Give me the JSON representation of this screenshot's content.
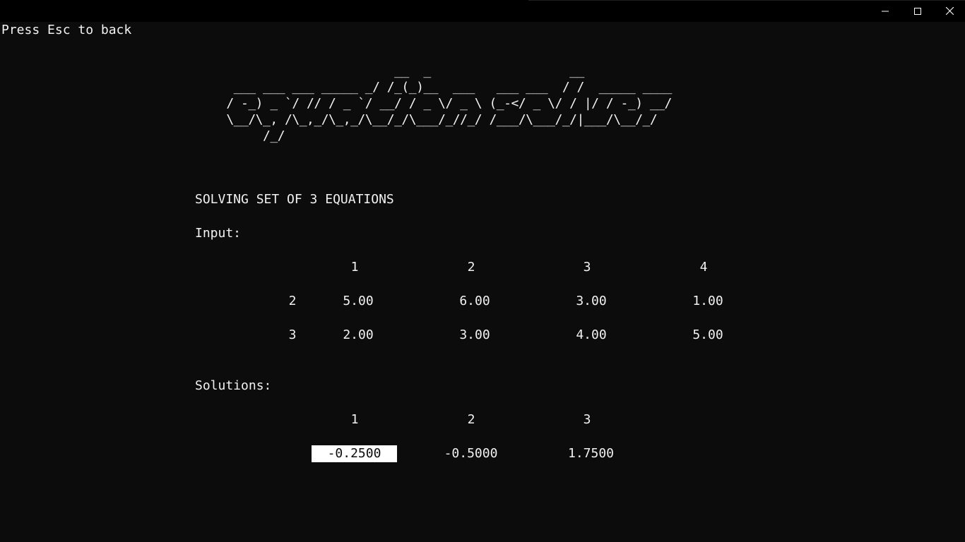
{
  "window": {
    "controls": {
      "minimize_icon": "minimize-icon",
      "maximize_icon": "maximize-icon",
      "close_icon": "close-icon"
    }
  },
  "hint": "Press Esc to back",
  "banner": {
    "text": "                        __  _                   __\n  ___ ___ ___ _____ _/ /_(_)__  ___   ___ ___  / /  _____ ____\n / -_) _ `/ // / _ `/ __/ / _ \\/ _ \\ (_-</ _ \\/ / |/ / -_) __/\n \\__/\\_, /\\_,_/\\_,_/\\__/_/\\___/_//_/ /___/\\___/_/|___/\\__/_/\n      /_/"
  },
  "heading": "SOLVING SET OF 3 EQUATIONS",
  "input": {
    "label": "Input:",
    "columns": [
      "1",
      "2",
      "3",
      "4"
    ],
    "rows": [
      {
        "index": "2",
        "values": [
          "5.00",
          "6.00",
          "3.00",
          "1.00"
        ]
      },
      {
        "index": "3",
        "values": [
          "2.00",
          "3.00",
          "4.00",
          "5.00"
        ]
      }
    ]
  },
  "solutions": {
    "label": "Solutions:",
    "columns": [
      "1",
      "2",
      "3"
    ],
    "values": [
      "-0.2500",
      "-0.5000",
      "1.7500"
    ],
    "selected_index": 0
  },
  "colors": {
    "background": "#0c0c0c",
    "foreground": "#f2f2f2",
    "selection_bg": "#ffffff",
    "selection_fg": "#0c0c0c"
  }
}
